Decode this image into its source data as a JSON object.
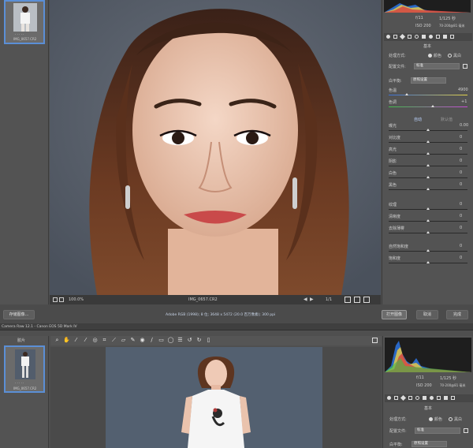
{
  "top": {
    "filmstrip": {
      "thumb_name": "IMG_0657.CR2",
      "stars": "· · · · ·"
    },
    "histogram_readout": {
      "r_label": "R:",
      "g_label": "G:",
      "b_label": "B:",
      "aperture": "f/11",
      "shutter": "1/125 秒",
      "iso": "ISO 200",
      "lens": "70-200@81 毫米"
    },
    "panel_title": "基本",
    "treatment_label": "处理方式:",
    "treatment_color": "颜色",
    "treatment_bw": "黑白",
    "profile_label": "配置文件:",
    "profile_value": "标准",
    "wb_label": "白平衡:",
    "wb_value": "原照设置",
    "temp_label": "色温",
    "temp_value": "4900",
    "tint_label": "色调",
    "tint_value": "+1",
    "auto_label": "自动",
    "default_label": "默认值",
    "sliders": [
      {
        "label": "曝光",
        "value": "0.00"
      },
      {
        "label": "对比度",
        "value": "0"
      },
      {
        "label": "高光",
        "value": "0"
      },
      {
        "label": "阴影",
        "value": "0"
      },
      {
        "label": "白色",
        "value": "0"
      },
      {
        "label": "黑色",
        "value": "0"
      },
      {
        "label": "纹理",
        "value": "0"
      },
      {
        "label": "清晰度",
        "value": "0"
      },
      {
        "label": "去除薄雾",
        "value": "0"
      },
      {
        "label": "自然饱和度",
        "value": "0"
      },
      {
        "label": "饱和度",
        "value": "0"
      }
    ],
    "zoom": "100.0%",
    "filename": "IMG_0657.CR2",
    "save_button": "存储图像...",
    "info_line": "Adobe RGB (1998); 8 位; 3648 x 5472 (20.0 百万像素); 300 ppi",
    "open_button": "打开图像",
    "cancel_button": "取消",
    "done_button": "完成",
    "page_indicator": "1/1"
  },
  "bottom": {
    "window_title": "Camera Raw 12.1 - Canon EOS 5D Mark IV",
    "filmstrip": {
      "header": "胶片",
      "thumb_name": "IMG_0657.CR2",
      "stars": "· · · · ·"
    },
    "histogram_readout": {
      "aperture": "f/11",
      "shutter": "1/125 秒",
      "iso": "ISO 200",
      "lens": "70-200@81 毫米"
    },
    "panel_title": "基本",
    "treatment_label": "处理方式:",
    "treatment_color": "颜色",
    "treatment_bw": "黑白",
    "profile_label": "配置文件:",
    "profile_value": "标准",
    "wb_label": "白平衡:",
    "wb_value": "原照设置"
  },
  "icons": [
    "zoom-icon",
    "hand-icon",
    "white-balance-icon",
    "color-sampler-icon",
    "targeted-adjust-icon",
    "crop-icon",
    "straighten-icon",
    "transform-icon",
    "spot-removal-icon",
    "red-eye-icon",
    "brush-icon",
    "graduated-filter-icon",
    "radial-filter-icon",
    "preferences-icon",
    "rotate-ccw-icon",
    "rotate-cw-icon",
    "trash-icon"
  ],
  "colors": {
    "background": "#4d4d4d",
    "panel": "#535353",
    "photo_backdrop": "#59626e",
    "accent": "#5b8fd6"
  }
}
